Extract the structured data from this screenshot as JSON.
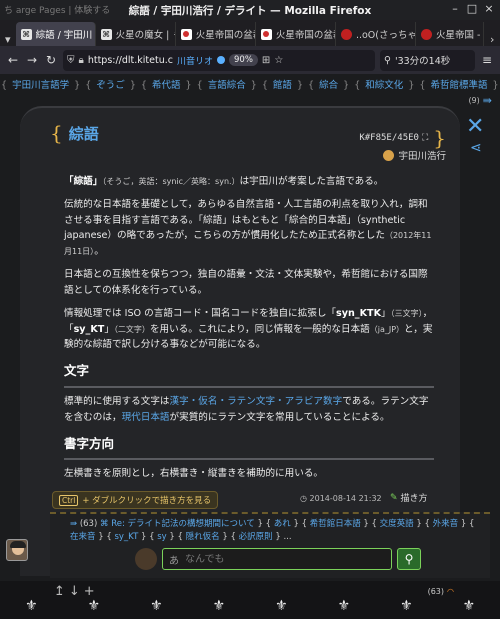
{
  "window": {
    "ghost_title": "ち arge Pages | 体験する",
    "title": "綜語 / 宇田川浩行 / デライト — Mozilla Firefox",
    "controls": [
      "–",
      "□",
      "×"
    ]
  },
  "tabs": [
    {
      "label": "綜語 / 宇田川",
      "icon": "delite-icon",
      "color": "#e6e6e6",
      "active": true
    },
    {
      "label": "火星の魔女 | ㇻ",
      "icon": "delite-icon",
      "color": "#e6e6e6",
      "active": false
    },
    {
      "label": "火星帝国の盆裁",
      "icon": "red-dot-icon",
      "color": "#d03030",
      "active": false
    },
    {
      "label": "火星帝国の盆裁",
      "icon": "red-dot-icon",
      "color": "#d03030",
      "active": false
    },
    {
      "label": "..oO(さっちゃん",
      "icon": "red-circle-icon",
      "color": "#c02020",
      "active": false
    },
    {
      "label": "火星帝国 - 画",
      "icon": "red-circle-icon",
      "color": "#c02020",
      "active": false
    }
  ],
  "navbar": {
    "back": "←",
    "forward": "→",
    "reload": "↻",
    "url": "https://dlt.kitetu.c",
    "extension_label": "川音リオ",
    "zoom": "90%",
    "search_value": "'33分の14秒",
    "menu": "≡"
  },
  "topnav": {
    "items": [
      "宇田川言語学",
      "ぞうご",
      "希代語",
      "言語綜合",
      "館語",
      "綜合",
      "和綜文化",
      "希哲館標準語",
      "言語"
    ],
    "count": "(9)"
  },
  "article": {
    "title": "綜語",
    "hexcode": "K#F85E/45E0",
    "author": "宇田川浩行",
    "p1_term": "「綜語」",
    "p1_small": "（そうご，英語：synic／英略：syn.）",
    "p1_rest": "は宇田川が考案した言語である。",
    "p2": "伝統的な日本語を基礎として，あらゆる自然言語・人工言語の利点を取り入れ，調和させる事を目指す言語である。「綜語」はもともと「綜合的日本語」（synthetic japanese）の略であったが，こちらの方が慣用化したため正式名称とした",
    "p2_small": "（2012年11月11日）",
    "p2_end": "。",
    "p3": "日本語との互換性を保ちつつ，独自の語彙・文法・文体実験や，希哲館における国際語としての体系化を行っている。",
    "p4_a": "情報処理では ISO の言語コード・国名コードを独自に拡張し「",
    "p4_code1": "syn_KTK",
    "p4_b": "」",
    "p4_small1": "（三文字）",
    "p4_c": "，「",
    "p4_code2": "sy_KT",
    "p4_d": "」",
    "p4_small2": "（二文字）",
    "p4_e": "を用いる。これにより，同じ情報を一般的な日本語",
    "p4_small3": "（ja_JP）",
    "p4_f": "と，実験的な綜語で訳し分ける事などが可能になる。",
    "sec1": "文字",
    "s1_a": "標準的に使用する文字は",
    "s1_link": "漢字・仮名・ラテン文字・アラビア数字",
    "s1_b": "である。ラテン文字を含むのは，",
    "s1_link2": "現代日本語",
    "s1_c": "が実質的にラテン文字を常用していることによる。",
    "sec2": "書字方向",
    "s2": "左横書きを原則とし，右横書き・縦書きを補助的に用いる。"
  },
  "hint": {
    "key": "Ctrl",
    "text": "+ ダブルクリックで描き方を見る"
  },
  "date": "2014-08-14 21:32",
  "draw_label": "描き方",
  "tags": {
    "count": "(63)",
    "items": [
      "Re: デライト記法の構想期間について",
      "あれ",
      "希哲館日本語",
      "交度英語",
      "外来音",
      "在来音",
      "sy_KT",
      "sy",
      "隠れ仮名",
      "必訳原則"
    ],
    "more": "..."
  },
  "search": {
    "placeholder": "なんでも",
    "value": ""
  },
  "footer": {
    "arrows": "↥↓+",
    "count": "(63)"
  }
}
